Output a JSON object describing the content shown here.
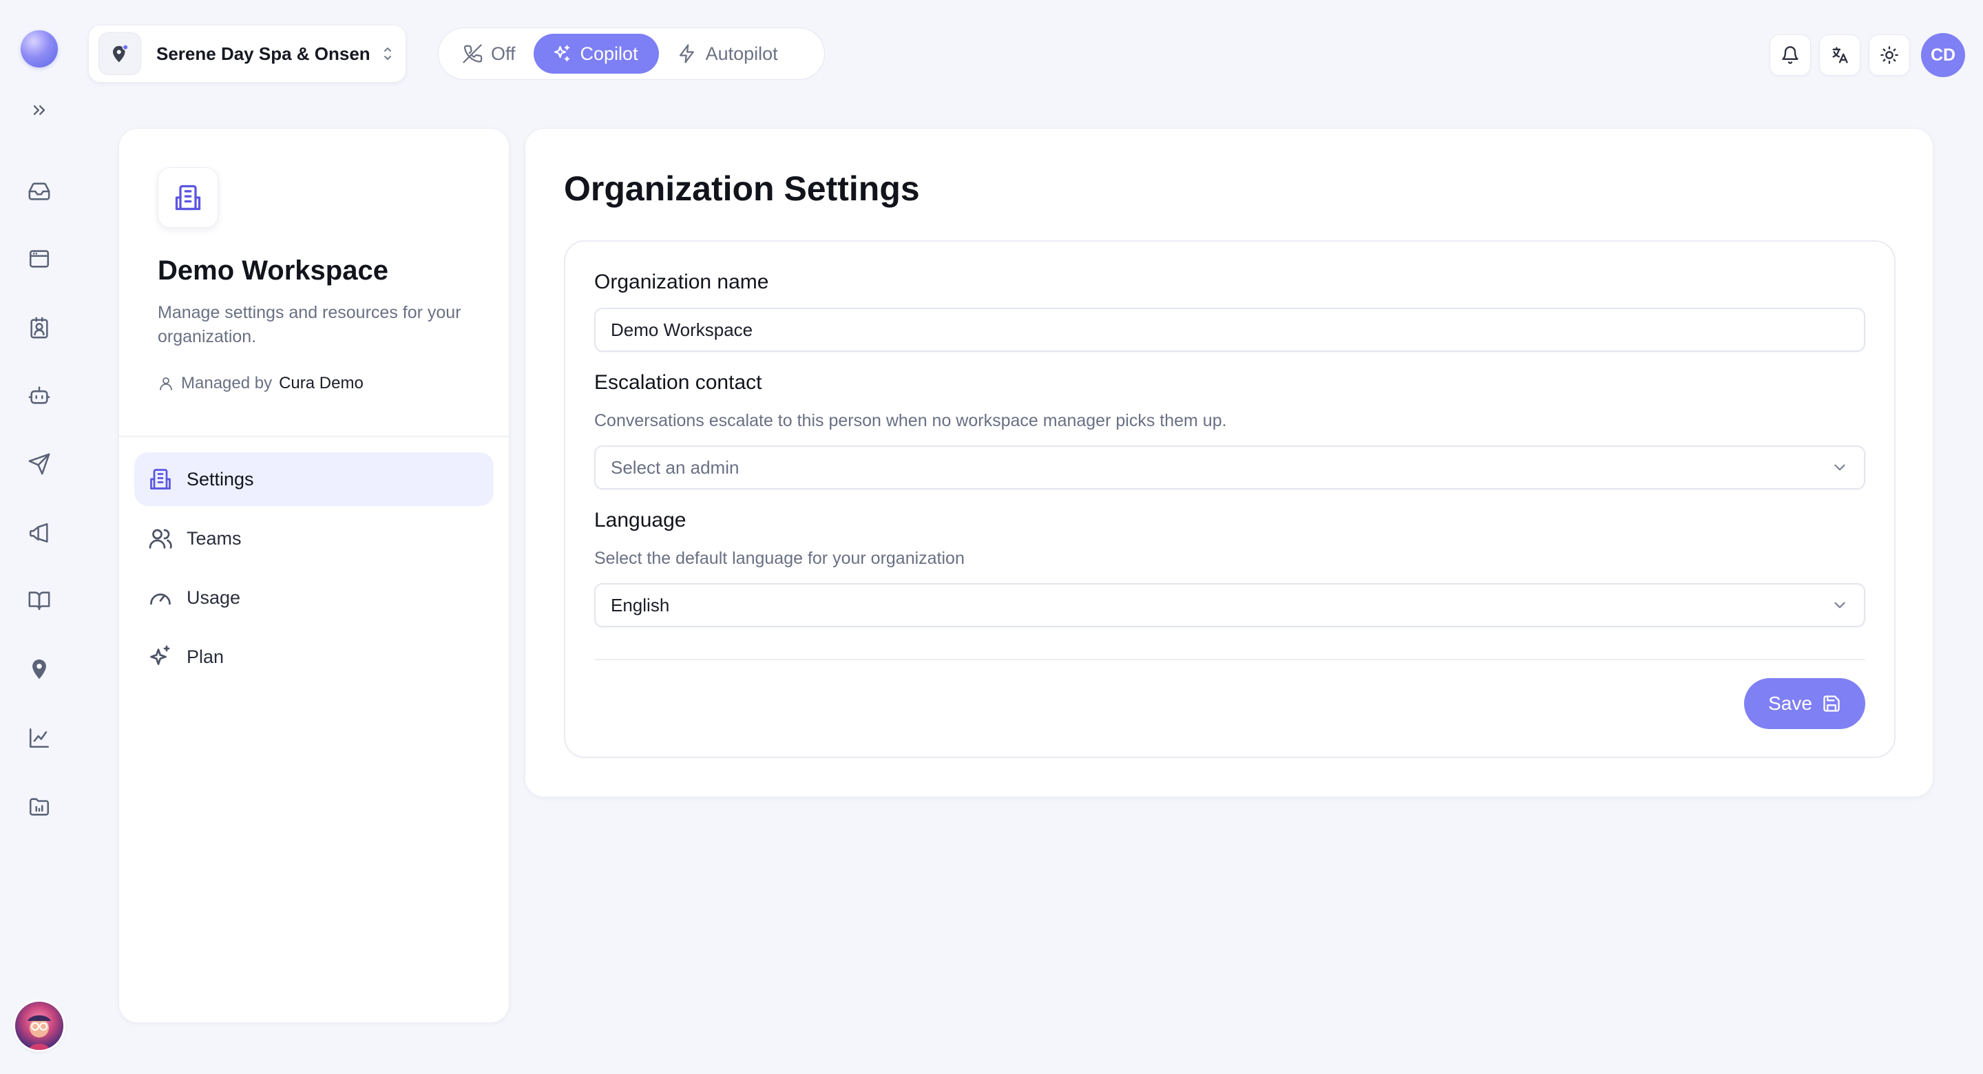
{
  "topbar": {
    "org_name": "Serene Day Spa & Onsen",
    "modes": [
      {
        "label": "Off",
        "icon": "phone-off-icon",
        "active": false
      },
      {
        "label": "Copilot",
        "icon": "sparkles-icon",
        "active": true
      },
      {
        "label": "Autopilot",
        "icon": "lightning-icon",
        "active": false
      }
    ],
    "user_initials": "CD"
  },
  "workspace": {
    "title": "Demo Workspace",
    "description": "Manage settings and resources for your organization.",
    "managed_prefix": "Managed by",
    "managed_name": "Cura Demo",
    "nav": [
      {
        "label": "Settings",
        "icon": "building-icon",
        "active": true
      },
      {
        "label": "Teams",
        "icon": "users-icon",
        "active": false
      },
      {
        "label": "Usage",
        "icon": "gauge-icon",
        "active": false
      },
      {
        "label": "Plan",
        "icon": "sparkles-icon",
        "active": false
      }
    ]
  },
  "settings": {
    "page_title": "Organization Settings",
    "org_name_label": "Organization name",
    "org_name_value": "Demo Workspace",
    "escalation_label": "Escalation contact",
    "escalation_help": "Conversations escalate to this person when no workspace manager picks them up.",
    "escalation_placeholder": "Select an admin",
    "language_label": "Language",
    "language_help": "Select the default language for your organization",
    "language_value": "English",
    "save_label": "Save"
  },
  "colors": {
    "accent": "#7f80f4",
    "nav_active_bg": "#eef0ff",
    "page_bg": "#f5f6fc"
  }
}
